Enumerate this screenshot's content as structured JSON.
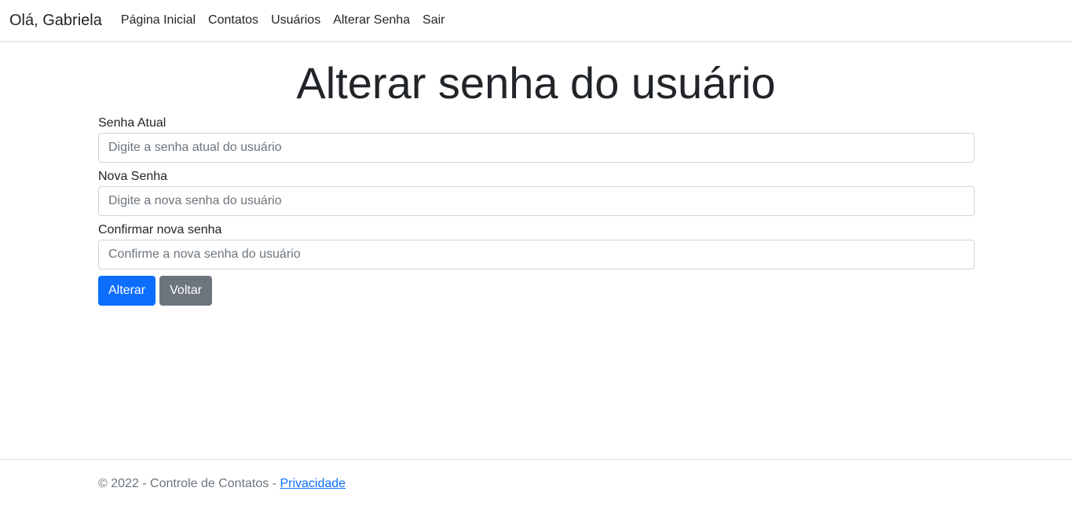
{
  "navbar": {
    "brand": "Olá, Gabriela",
    "links": [
      "Página Inicial",
      "Contatos",
      "Usuários",
      "Alterar Senha",
      "Sair"
    ]
  },
  "page": {
    "title": "Alterar senha do usuário"
  },
  "form": {
    "current_password": {
      "label": "Senha Atual",
      "placeholder": "Digite a senha atual do usuário",
      "value": ""
    },
    "new_password": {
      "label": "Nova Senha",
      "placeholder": "Digite a nova senha do usuário",
      "value": ""
    },
    "confirm_password": {
      "label": "Confirmar nova senha",
      "placeholder": "Confirme a nova senha do usuário",
      "value": ""
    },
    "submit_label": "Alterar",
    "back_label": "Voltar"
  },
  "footer": {
    "text": "© 2022 - Controle de Contatos - ",
    "privacy_link": "Privacidade"
  },
  "colors": {
    "primary": "#0d6efd",
    "secondary": "#6c757d",
    "text": "#212529",
    "muted": "#6c757d"
  }
}
